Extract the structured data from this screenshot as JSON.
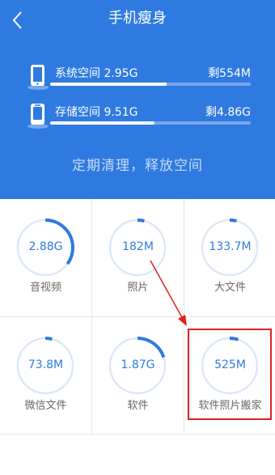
{
  "header": {
    "title": "手机瘦身",
    "back_icon": "chevron-left-icon",
    "background": "#2f7ae0"
  },
  "storage": {
    "system": {
      "label": "系统空间",
      "used": "2.95G",
      "remaining": "剩554M",
      "fill_fraction": 0.58,
      "icon": "phone-icon"
    },
    "internal": {
      "label": "存储空间",
      "used": "9.51G",
      "remaining": "剩4.86G",
      "fill_fraction": 0.52,
      "icon": "storage-icon"
    }
  },
  "slogan": "定期清理，释放空间",
  "categories": [
    {
      "id": "audio-video",
      "value": "2.88G",
      "label": "音视频",
      "arc_fraction": 0.35
    },
    {
      "id": "photos",
      "value": "182M",
      "label": "照片",
      "arc_fraction": 0.04
    },
    {
      "id": "large-files",
      "value": "133.7M",
      "label": "大文件",
      "arc_fraction": 0.04
    },
    {
      "id": "wechat-files",
      "value": "73.8M",
      "label": "微信文件",
      "arc_fraction": 0.04
    },
    {
      "id": "software",
      "value": "1.87G",
      "label": "软件",
      "arc_fraction": 0.2
    },
    {
      "id": "photo-mover",
      "value": "525M",
      "label": "软件照片搬家",
      "arc_fraction": 0.05
    }
  ],
  "colors": {
    "accent": "#2f7ae0",
    "ring_track": "#dce8f8",
    "annotation": "#e02020"
  }
}
